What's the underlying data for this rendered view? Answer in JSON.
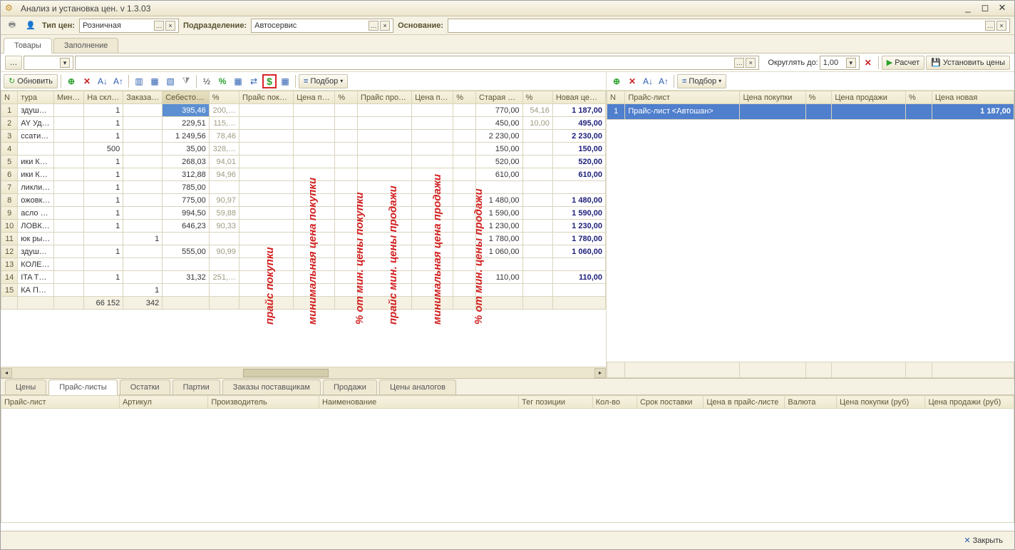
{
  "window": {
    "title": "Анализ и установка цен. v 1.3.03"
  },
  "toolbar": {
    "price_type_label": "Тип цен:",
    "price_type_value": "Розничная",
    "subdivision_label": "Подразделение:",
    "subdivision_value": "Автосервис",
    "basis_label": "Основание:",
    "basis_value": ""
  },
  "tabs_top": [
    {
      "label": "Товары",
      "active": true
    },
    {
      "label": "Заполнение",
      "active": false
    }
  ],
  "toolbar2": {
    "round_label": "Округлять до:",
    "round_value": "1,00",
    "calc_label": "Расчет",
    "set_label": "Установить цены"
  },
  "left_grid_toolbar": {
    "refresh_label": "Обновить",
    "select_label": "Подбор"
  },
  "right_grid_toolbar": {
    "select_label": "Подбор"
  },
  "left_grid": {
    "headers": [
      "N",
      "тура",
      "Мин.о…",
      "На скла…",
      "Заказа…",
      "Себестои…",
      "%",
      "Прайс поку…",
      "Цена по…",
      "%",
      "Прайс прод…",
      "Цена пр…",
      "%",
      "Старая ц…",
      "%",
      "Новая це…"
    ],
    "rows": [
      {
        "n": "1",
        "t": "здуш…",
        "min": "",
        "stk": "1",
        "ord": "",
        "cost": "395,46",
        "p1": "200,…",
        "buy": "",
        "bv": "",
        "bp": "",
        "sell": "",
        "sv": "",
        "sp": "",
        "old": "770,00",
        "op": "54,16",
        "new": "1 187,00",
        "sel": true
      },
      {
        "n": "2",
        "t": "AY Уд…",
        "min": "",
        "stk": "1",
        "ord": "",
        "cost": "229,51",
        "p1": "115,…",
        "buy": "",
        "bv": "",
        "bp": "",
        "sell": "",
        "sv": "",
        "sp": "",
        "old": "450,00",
        "op": "10,00",
        "new": "495,00"
      },
      {
        "n": "3",
        "t": "ссати…",
        "min": "",
        "stk": "1",
        "ord": "",
        "cost": "1 249,56",
        "p1": "78,46",
        "buy": "",
        "bv": "",
        "bp": "",
        "sell": "",
        "sv": "",
        "sp": "",
        "old": "2 230,00",
        "op": "",
        "new": "2 230,00"
      },
      {
        "n": "4",
        "t": "",
        "min": "",
        "stk": "500",
        "ord": "",
        "cost": "35,00",
        "p1": "328,…",
        "buy": "",
        "bv": "",
        "bp": "",
        "sell": "",
        "sv": "",
        "sp": "",
        "old": "150,00",
        "op": "",
        "new": "150,00"
      },
      {
        "n": "5",
        "t": "ики К…",
        "min": "",
        "stk": "1",
        "ord": "",
        "cost": "268,03",
        "p1": "94,01",
        "buy": "",
        "bv": "",
        "bp": "",
        "sell": "",
        "sv": "",
        "sp": "",
        "old": "520,00",
        "op": "",
        "new": "520,00"
      },
      {
        "n": "6",
        "t": "ики К…",
        "min": "",
        "stk": "1",
        "ord": "",
        "cost": "312,88",
        "p1": "94,96",
        "buy": "",
        "bv": "",
        "bp": "",
        "sell": "",
        "sv": "",
        "sp": "",
        "old": "610,00",
        "op": "",
        "new": "610,00"
      },
      {
        "n": "7",
        "t": "ликли…",
        "min": "",
        "stk": "1",
        "ord": "",
        "cost": "785,00",
        "p1": "",
        "buy": "",
        "bv": "",
        "bp": "",
        "sell": "",
        "sv": "",
        "sp": "",
        "old": "",
        "op": "",
        "new": ""
      },
      {
        "n": "8",
        "t": "ожовк…",
        "min": "",
        "stk": "1",
        "ord": "",
        "cost": "775,00",
        "p1": "90,97",
        "buy": "",
        "bv": "",
        "bp": "",
        "sell": "",
        "sv": "",
        "sp": "",
        "old": "1 480,00",
        "op": "",
        "new": "1 480,00"
      },
      {
        "n": "9",
        "t": "асло т…",
        "min": "",
        "stk": "1",
        "ord": "",
        "cost": "994,50",
        "p1": "59,88",
        "buy": "",
        "bv": "",
        "bp": "",
        "sell": "",
        "sv": "",
        "sp": "",
        "old": "1 590,00",
        "op": "",
        "new": "1 590,00"
      },
      {
        "n": "10",
        "t": "ЛОВК…",
        "min": "",
        "stk": "1",
        "ord": "",
        "cost": "646,23",
        "p1": "90,33",
        "buy": "",
        "bv": "",
        "bp": "",
        "sell": "",
        "sv": "",
        "sp": "",
        "old": "1 230,00",
        "op": "",
        "new": "1 230,00"
      },
      {
        "n": "11",
        "t": "юк ры…",
        "min": "",
        "stk": "",
        "ord": "1",
        "cost": "",
        "p1": "",
        "buy": "",
        "bv": "",
        "bp": "",
        "sell": "",
        "sv": "",
        "sp": "",
        "old": "1 780,00",
        "op": "",
        "new": "1 780,00"
      },
      {
        "n": "12",
        "t": "здуш…",
        "min": "",
        "stk": "1",
        "ord": "",
        "cost": "555,00",
        "p1": "90,99",
        "buy": "",
        "bv": "",
        "bp": "",
        "sell": "",
        "sv": "",
        "sp": "",
        "old": "1 060,00",
        "op": "",
        "new": "1 060,00"
      },
      {
        "n": "13",
        "t": "КОЛЕ…",
        "min": "",
        "stk": "",
        "ord": "",
        "cost": "",
        "p1": "",
        "buy": "",
        "bv": "",
        "bp": "",
        "sell": "",
        "sv": "",
        "sp": "",
        "old": "",
        "op": "",
        "new": ""
      },
      {
        "n": "14",
        "t": "ITA TO…",
        "min": "",
        "stk": "1",
        "ord": "",
        "cost": "31,32",
        "p1": "251,…",
        "buy": "",
        "bv": "",
        "bp": "",
        "sell": "",
        "sv": "",
        "sp": "",
        "old": "110,00",
        "op": "",
        "new": "110,00"
      },
      {
        "n": "15",
        "t": "КА ПР…",
        "min": "",
        "stk": "",
        "ord": "1",
        "cost": "",
        "p1": "",
        "buy": "",
        "bv": "",
        "bp": "",
        "sell": "",
        "sv": "",
        "sp": "",
        "old": "",
        "op": "",
        "new": ""
      }
    ],
    "footer": {
      "stk": "66 152",
      "ord": "342"
    }
  },
  "right_grid": {
    "headers": [
      "N",
      "Прайс-лист",
      "Цена покупки",
      "%",
      "Цена продажи",
      "%",
      "Цена новая"
    ],
    "rows": [
      {
        "n": "1",
        "name": "Прайс-лист <Автошан>",
        "buy": "",
        "bp": "",
        "sell": "",
        "sp": "",
        "new": "1 187,00"
      }
    ]
  },
  "tabs_bottom": [
    {
      "label": "Цены"
    },
    {
      "label": "Прайс-листы",
      "active": true
    },
    {
      "label": "Остатки"
    },
    {
      "label": "Партии"
    },
    {
      "label": "Заказы поставщикам"
    },
    {
      "label": "Продажи"
    },
    {
      "label": "Цены аналогов"
    }
  ],
  "bottom_grid": {
    "headers": [
      "Прайс-лист",
      "Артикул",
      "Производитель",
      "Наименование",
      "Тег позиции",
      "Кол-во",
      "Срок поставки",
      "Цена в прайс-листе",
      "Валюта",
      "Цена покупки (руб)",
      "Цена продажи (руб)"
    ]
  },
  "footer": {
    "close_label": "Закрыть"
  },
  "overlays": {
    "a": "прайс покупки",
    "b": "минимальная цена покупки",
    "c": "% от мин. цены покупки",
    "d": "прайс мин. цены продажи",
    "e": "минимальная цена продажи",
    "f": "% от мин. цены продажи"
  }
}
